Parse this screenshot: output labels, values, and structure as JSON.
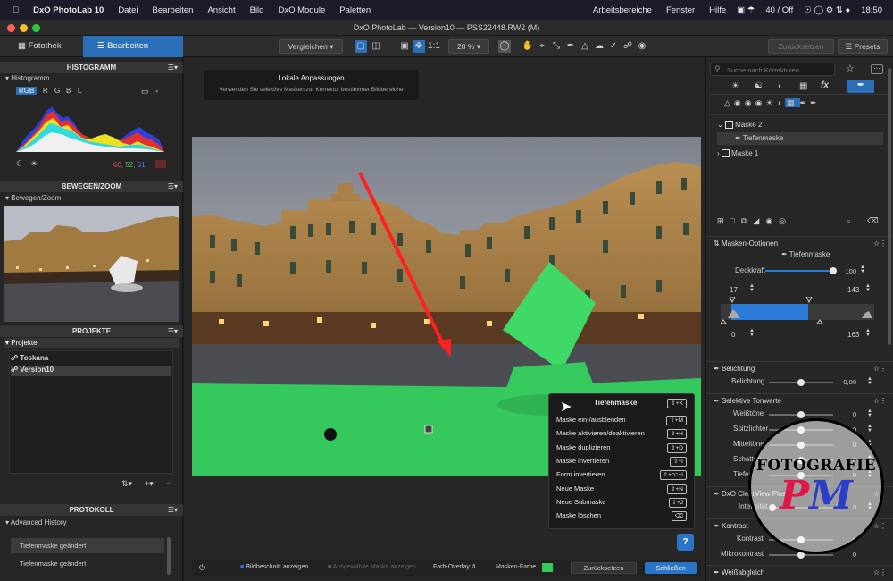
{
  "menubar": {
    "apple": "",
    "app": "DxO PhotoLab 10",
    "items": [
      "Datei",
      "Bearbeiten",
      "Ansicht",
      "Bild",
      "DxO Module",
      "Paletten"
    ],
    "right_items": [
      "Arbeitsbereiche",
      "Fenster",
      "Hilfe"
    ],
    "status": "40 / Off",
    "time": "18:50"
  },
  "window": {
    "title": "DxO PhotoLab — Version10 — PSS22448.RW2 (M)"
  },
  "toolbar": {
    "tab_library": "Fotothek",
    "tab_edit": "Bearbeiten",
    "compare": "Vergleichen",
    "ratio": "1:1",
    "zoom": "28 %",
    "reset": "Zurücksetzen",
    "presets": "Presets"
  },
  "left": {
    "histogram": {
      "title": "HISTOGRAMM",
      "sub": "Histogramm",
      "channels": [
        "RGB",
        "R",
        "G",
        "B",
        "L"
      ],
      "values": [
        "60,",
        "52,",
        "51"
      ]
    },
    "move": {
      "title": "BEWEGEN/ZOOM",
      "sub": "Bewegen/Zoom"
    },
    "projects": {
      "title": "PROJEKTE",
      "sub": "Projekte",
      "items": [
        "Toskana",
        "Version10"
      ]
    },
    "history": {
      "title": "PROTOKOLL",
      "sub": "Advanced History",
      "items": [
        "Tiefenmaske geändert",
        "Tiefenmaske geändert"
      ]
    }
  },
  "center": {
    "tooltip_title": "Lokale Anpassungen",
    "tooltip_text": "Verwenden Sie selektive Masken zur Korrektur bestimmter Bildbereiche",
    "context_menu": {
      "title": "Tiefenmaske",
      "title_key": "⇧+K",
      "items": [
        {
          "label": "Maske ein-/ausblenden",
          "key": "⇧+M"
        },
        {
          "label": "Maske aktivieren/deaktivieren",
          "key": "⇧+H"
        },
        {
          "label": "Maske duplizieren",
          "key": "⇧+D"
        },
        {
          "label": "Maske invertieren",
          "key": "⇧+I"
        },
        {
          "label": "Form invertieren",
          "key": "⇧+⌥+I"
        },
        {
          "label": "Neue Maske",
          "key": "⇧+N"
        },
        {
          "label": "Neue Submaske",
          "key": "⇧+J"
        },
        {
          "label": "Maske löschen",
          "key": "⌫"
        }
      ]
    },
    "bottom": {
      "show_crop": "Bildbeschnitt anzeigen",
      "show_mask": "Ausgewählte Maske anzeigen",
      "overlay": "Farb-Overlay",
      "mask_color_label": "Masken-Farbe",
      "reset": "Zurücksetzen",
      "close": "Schließen"
    },
    "help": "?"
  },
  "right": {
    "search_placeholder": "Suche nach Korrekturen",
    "masks": [
      "Maske 2",
      "Tiefenmaske",
      "Maske 1"
    ],
    "mask_options_title": "Masken-Optionen",
    "mask_type": "Tiefenmaske",
    "opacity_label": "Deckkraft",
    "opacity_value": "100",
    "opacity_level": 1.0,
    "range_low": "17",
    "range_high": "143",
    "range_low2": "0",
    "range_high2": "163",
    "exposure_title": "Belichtung",
    "exposure_label": "Belichtung",
    "exposure_value": "0,00",
    "tones_title": "Selektive Tonwerte",
    "tones": [
      {
        "label": "Weißtöne",
        "value": "0"
      },
      {
        "label": "Spitzlichter",
        "value": "0"
      },
      {
        "label": "Mitteltöne",
        "value": "0"
      },
      {
        "label": "Schatten",
        "value": "0"
      },
      {
        "label": "Tiefen",
        "value": "0"
      }
    ],
    "clearview_title": "DxO ClearView Plus",
    "clearview_label": "Intensität",
    "clearview_value": "0",
    "contrast_title": "Kontrast",
    "contrast_items": [
      {
        "label": "Kontrast",
        "value": "0"
      },
      {
        "label": "Mikrokontrast",
        "value": "0"
      }
    ],
    "wb_title": "Weißabgleich"
  },
  "watermark": {
    "text": "FOTOGRAFIE",
    "letters": "PM"
  },
  "colors": {
    "accent": "#2b7bd8",
    "mask_green": "#35c85c",
    "close_btn": "#2a74c9"
  }
}
